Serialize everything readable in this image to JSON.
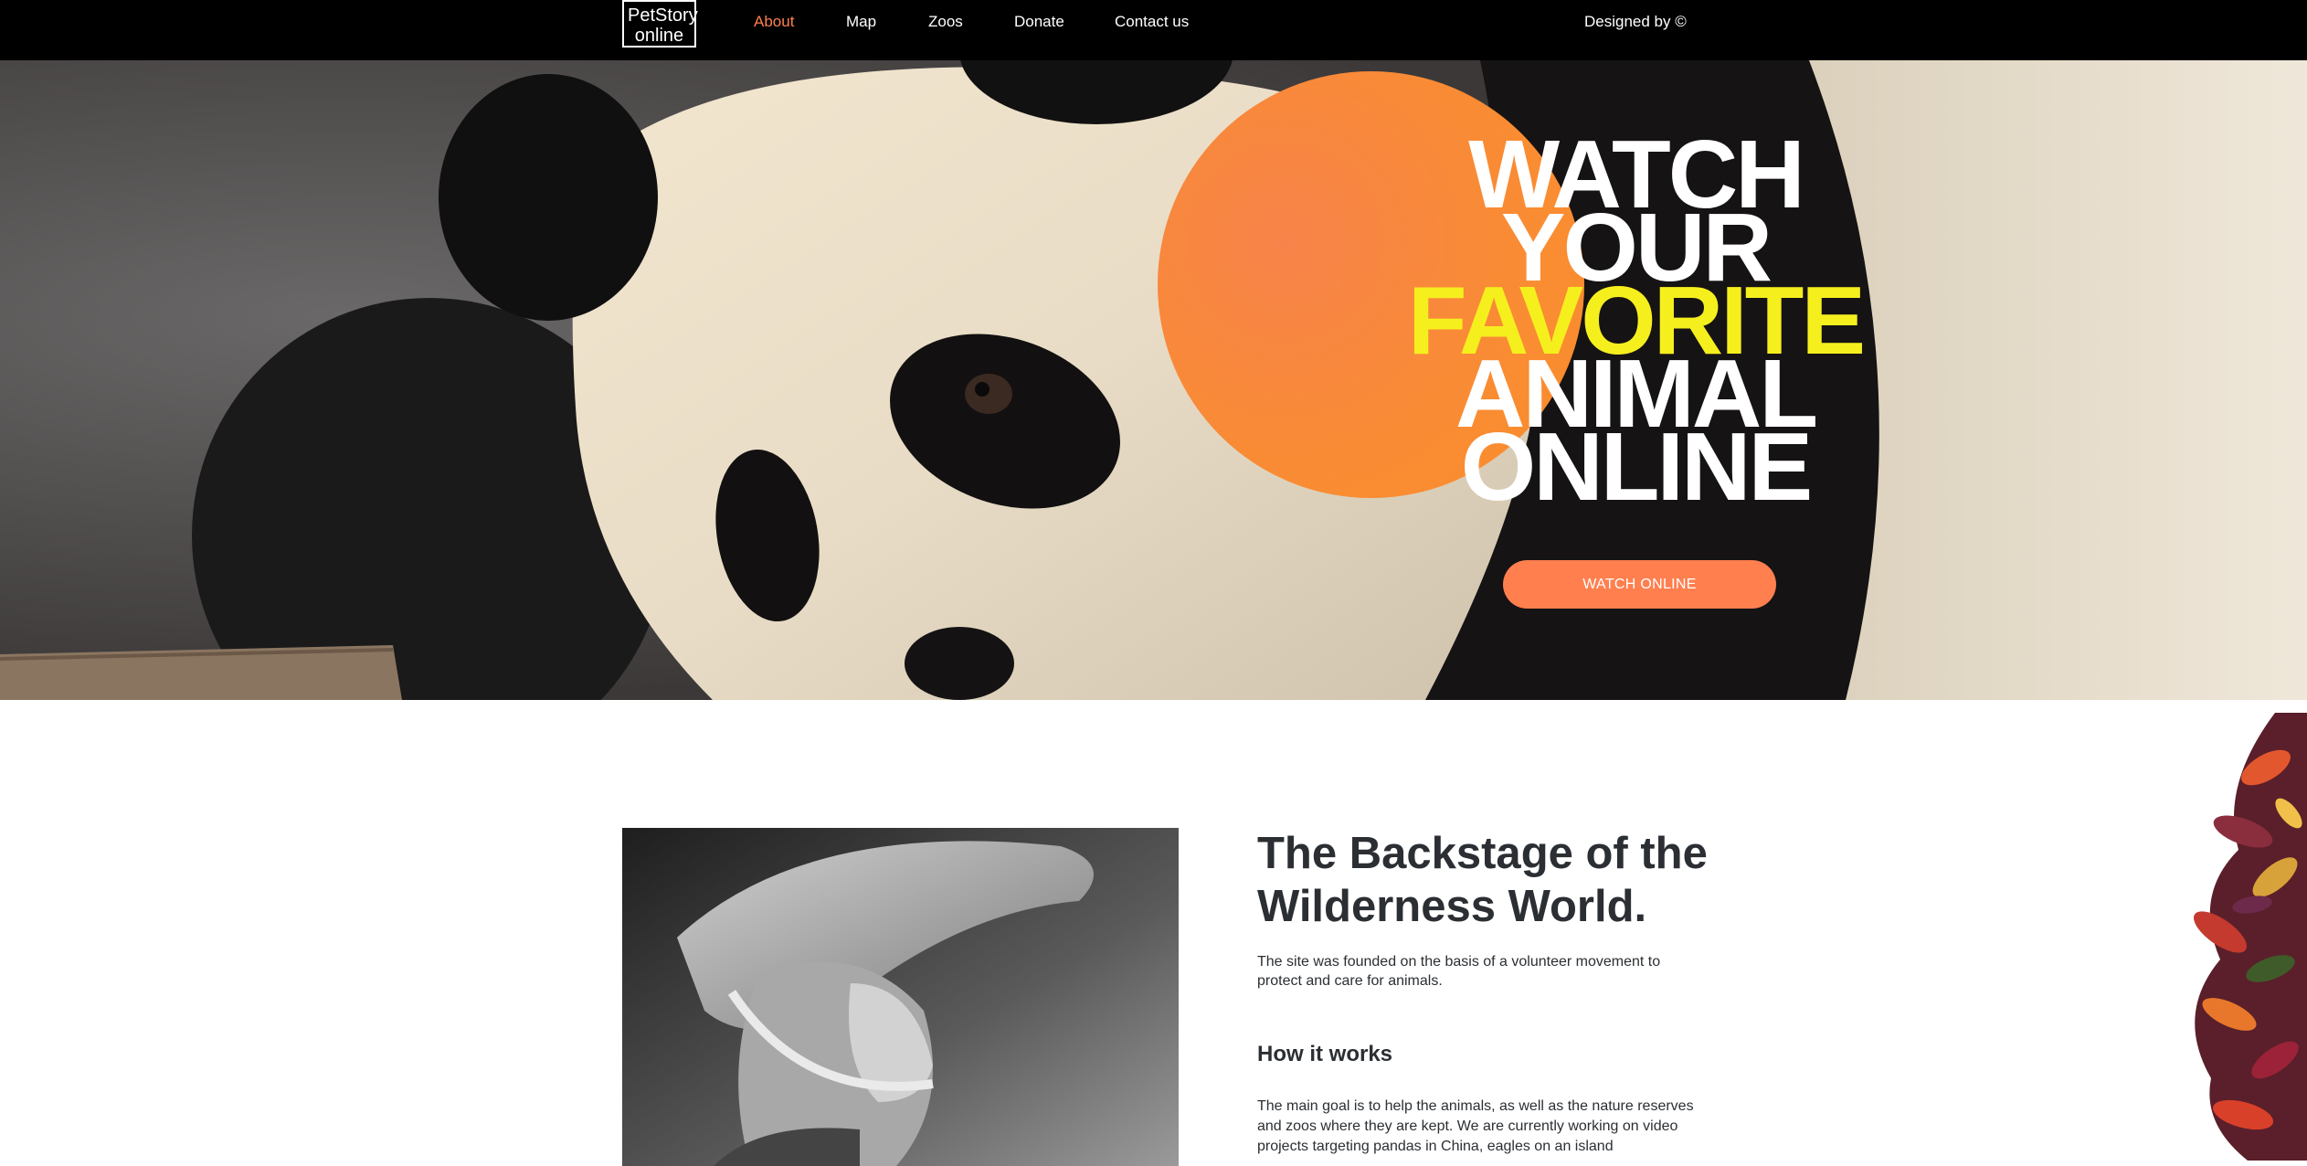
{
  "logo": {
    "line1": "PetStory",
    "line2": "online"
  },
  "nav": {
    "items": [
      {
        "label": "About",
        "active": true
      },
      {
        "label": "Map",
        "active": false
      },
      {
        "label": "Zoos",
        "active": false
      },
      {
        "label": "Donate",
        "active": false
      },
      {
        "label": "Contact us",
        "active": false
      }
    ],
    "designed_by": "Designed by ©"
  },
  "hero": {
    "headline": [
      "WATCH",
      "YOUR",
      "FAVORITE",
      "ANIMAL",
      "ONLINE"
    ],
    "button_label": "WATCH ONLINE"
  },
  "about": {
    "title": "The Backstage of the Wilderness World.",
    "intro": "The site was founded on the basis of a volunteer movement to protect and care for animals.",
    "how_title": "How it works",
    "how_body": "The main goal is to help the animals, as well as the nature reserves and zoos where they are kept. We are currently working on video projects targeting pandas in China, eagles on an island"
  },
  "colors": {
    "accent": "#ff7f4f",
    "nav_bg": "#000000",
    "headline_yellow": "#f6ef1e",
    "text_dark": "#2b2f33"
  }
}
